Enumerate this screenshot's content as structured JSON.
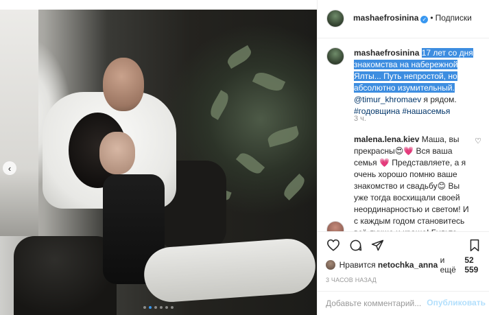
{
  "post": {
    "username": "mashaefrosinina",
    "follow_separator": "•",
    "follow_label": "Подписки",
    "carousel_prev": "‹",
    "carousel_dots": 6,
    "carousel_active_index": 1
  },
  "caption": {
    "username": "mashaefrosinina",
    "highlighted_text": "17 лет со дня знакомства на набережной Ялты... Путь непростой, но абсолютно изумительный.",
    "mention": "@timur_khromaev",
    "mention_suffix": " я рядом.",
    "hashtags": "#годовщина #нашасемья",
    "time_ago": "3 ч."
  },
  "comments": [
    {
      "username": "malena.lena.kiev",
      "text": " Маша, вы прекрасны😍💗 Вся ваша семья 💗 Представляете, а я очень хорошо помню ваше знакомство и свадьбу😊 Вы уже тогда восхищали своей неординарностью и светом! И с каждым годом становитесь всё лучше и краше! Будьте счастливы💗 P.S. Помню, что в то время имя Тимур было",
      "like_icon": "♡"
    }
  ],
  "actions": {
    "like_icon": "heart-outline-icon",
    "comment_icon": "comment-bubble-icon",
    "share_icon": "paper-plane-icon",
    "save_icon": "bookmark-icon"
  },
  "likes": {
    "prefix": "Нравится",
    "user": "netochka_anna",
    "suffix": "и ещё",
    "count": "52 559"
  },
  "posted_time": "3 ЧАСОВ НАЗАД",
  "comment_form": {
    "placeholder": "Добавьте комментарий...",
    "publish_label": "Опубликовать"
  },
  "colors": {
    "accent": "#3897f0",
    "highlight": "#3d8de0",
    "link": "#003569",
    "muted": "#999999",
    "publish_disabled": "#b2dffc"
  }
}
